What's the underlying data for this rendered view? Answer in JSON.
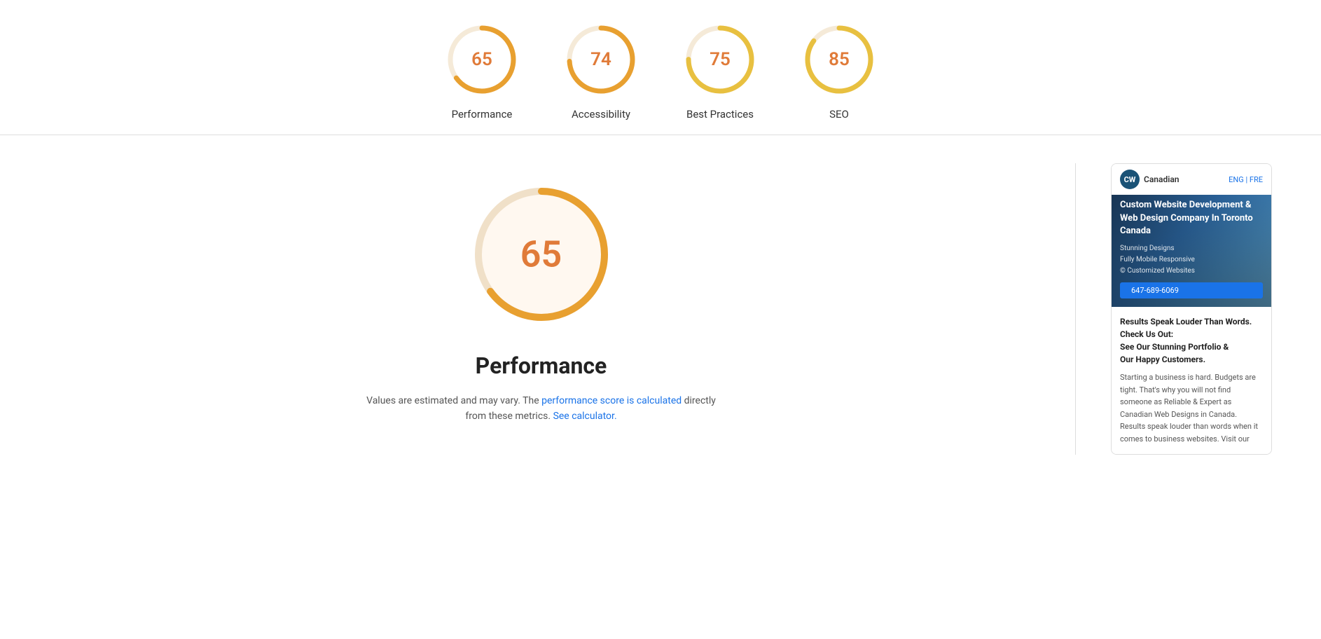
{
  "scores": [
    {
      "id": "performance",
      "value": 65,
      "label": "Performance",
      "color": "#e8a030",
      "percent": 65
    },
    {
      "id": "accessibility",
      "value": 74,
      "label": "Accessibility",
      "color": "#e8a030",
      "percent": 74
    },
    {
      "id": "best-practices",
      "value": 75,
      "label": "Best Practices",
      "color": "#e8c040",
      "percent": 75
    },
    {
      "id": "seo",
      "value": 85,
      "label": "SEO",
      "color": "#e8c040",
      "percent": 85
    }
  ],
  "main": {
    "score_value": "65",
    "score_title": "Performance",
    "description_static": "Values are estimated and may vary. The ",
    "link1_text": "performance score is calculated",
    "description_mid": " directly from these metrics. ",
    "link2_text": "See calculator.",
    "description_end": ""
  },
  "ad": {
    "logo_text": "Canadian",
    "logo_abbr": "CW",
    "lang_text": "ENG | FRE",
    "headline": "Custom Website Development & Web Design Company In Toronto Canada",
    "feature1": "Stunning Designs",
    "feature2": "Fully Mobile Responsive",
    "feature3": "© Customized Websites",
    "phone": "647-689-6069",
    "tagline": "Results Speak Louder Than Words.\nCheck Us Out:\nSee Our Stunning Portfolio &\nOur Happy Customers.",
    "body": "Starting a business is hard. Budgets are tight. That's why you will not find someone as Reliable & Expert as Canadian Web Designs in Canada. Results speak louder than words when it comes to business websites. Visit our"
  }
}
